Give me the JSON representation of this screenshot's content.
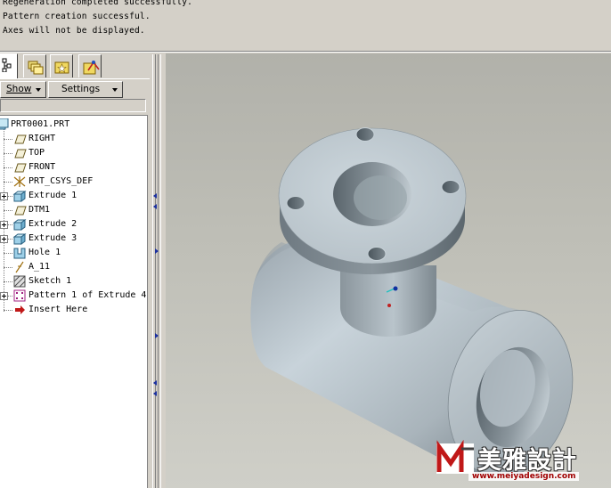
{
  "messages": [
    "Regeneration completed successfully.",
    "Pattern creation successful.",
    "Axes will not be displayed."
  ],
  "navigator": {
    "tabs": [
      {
        "icon": "model-tree-icon"
      },
      {
        "icon": "folder-browser-icon"
      },
      {
        "icon": "favorites-icon"
      },
      {
        "icon": "connections-icon"
      }
    ],
    "show_label": "Show",
    "settings_label": "Settings"
  },
  "model_tree": {
    "root": "PRT0001.PRT",
    "items": [
      {
        "label": "RIGHT",
        "icon": "datum-plane-icon",
        "expandable": false
      },
      {
        "label": "TOP",
        "icon": "datum-plane-icon",
        "expandable": false
      },
      {
        "label": "FRONT",
        "icon": "datum-plane-icon",
        "expandable": false
      },
      {
        "label": "PRT_CSYS_DEF",
        "icon": "coordinate-system-icon",
        "expandable": false
      },
      {
        "label": "Extrude 1",
        "icon": "extrude-icon",
        "expandable": true
      },
      {
        "label": "DTM1",
        "icon": "datum-plane-icon",
        "expandable": false
      },
      {
        "label": "Extrude 2",
        "icon": "extrude-icon",
        "expandable": true
      },
      {
        "label": "Extrude 3",
        "icon": "extrude-icon",
        "expandable": true
      },
      {
        "label": "Hole 1",
        "icon": "hole-icon",
        "expandable": false
      },
      {
        "label": "A_11",
        "icon": "datum-axis-icon",
        "expandable": false
      },
      {
        "label": "Sketch 1",
        "icon": "sketch-icon",
        "expandable": false
      },
      {
        "label": "Pattern 1 of Extrude 4",
        "icon": "pattern-icon",
        "expandable": true
      },
      {
        "label": "Insert Here",
        "icon": "insert-here-icon",
        "expandable": false
      }
    ]
  },
  "watermark": {
    "title": "美雅設計",
    "url": "www.meiyadesign.com"
  },
  "colors": {
    "background": "#d4d0c8",
    "viewport_top": "#b1b1aa",
    "viewport_bottom": "#cfcfc8",
    "model_light": "#c7d2d8",
    "model_dark": "#5f6a72",
    "splitter_arrow": "#1a2fa0",
    "insert_arrow": "#c01818"
  }
}
